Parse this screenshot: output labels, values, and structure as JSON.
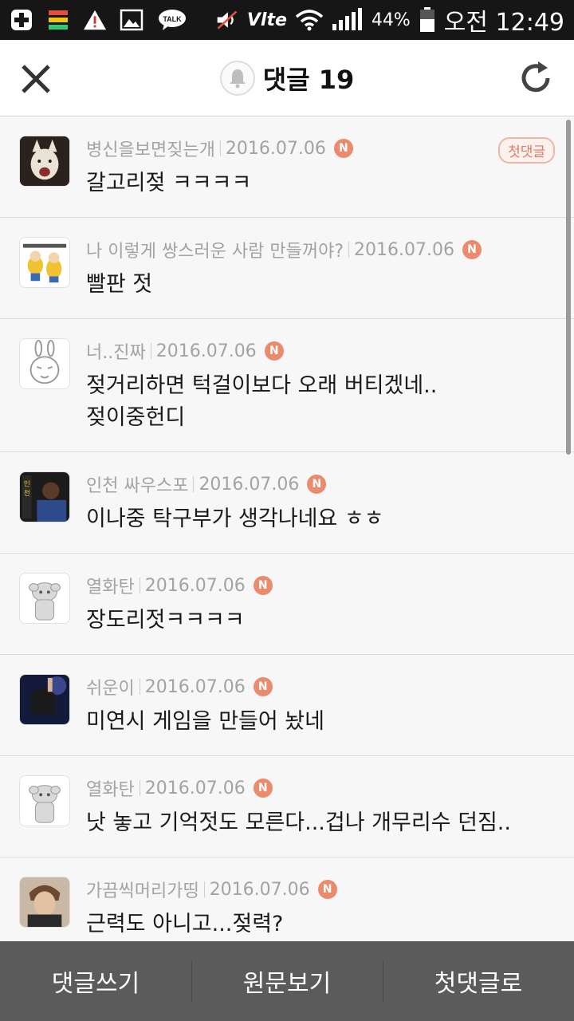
{
  "status_bar": {
    "left_icons": [
      "plus-icon",
      "storage-icon",
      "warning-icon",
      "image-icon",
      "talk-icon"
    ],
    "talk_label": "TALK",
    "volte_label": "Vlte",
    "battery_percent": "44%",
    "time": "오전 12:49"
  },
  "header": {
    "title": "댓글 19"
  },
  "badge_first": "첫댓글",
  "new_marker": "N",
  "comments": [
    {
      "user": "병신을보면짖는개",
      "date": "2016.07.06",
      "text": "갈고리젖 ㅋㅋㅋㅋ",
      "avatar_color": "#3a2f2a"
    },
    {
      "user": "나 이렇게 쌍스러운 사람 만들꺼야?",
      "date": "2016.07.06",
      "text": "빨판 젓",
      "avatar_color": "#f1c232"
    },
    {
      "user": "너..진짜",
      "date": "2016.07.06",
      "text": "젖거리하면 턱걸이보다 오래 버티겠네..\n젖이중헌디",
      "avatar_color": "#ffffff"
    },
    {
      "user": "인천 싸우스포",
      "date": "2016.07.06",
      "text": "이나중 탁구부가 생각나네요 ㅎㅎ",
      "avatar_color": "#2d3a6b"
    },
    {
      "user": "열화탄",
      "date": "2016.07.06",
      "text": "장도리젓ㅋㅋㅋㅋ",
      "avatar_color": "#ffffff"
    },
    {
      "user": "쉬운이",
      "date": "2016.07.06",
      "text": "미연시 게임을 만들어 놨네",
      "avatar_color": "#1e2450"
    },
    {
      "user": "열화탄",
      "date": "2016.07.06",
      "text": "낫 놓고 기억젓도 모른다...겁나 개무리수 던짐..",
      "avatar_color": "#ffffff"
    },
    {
      "user": "가끔씩머리가띵",
      "date": "2016.07.06",
      "text": "근력도 아니고...젖력?",
      "avatar_color": "#7a5a43"
    }
  ],
  "bottom_bar": {
    "write": "댓글쓰기",
    "original": "원문보기",
    "first": "첫댓글로"
  }
}
